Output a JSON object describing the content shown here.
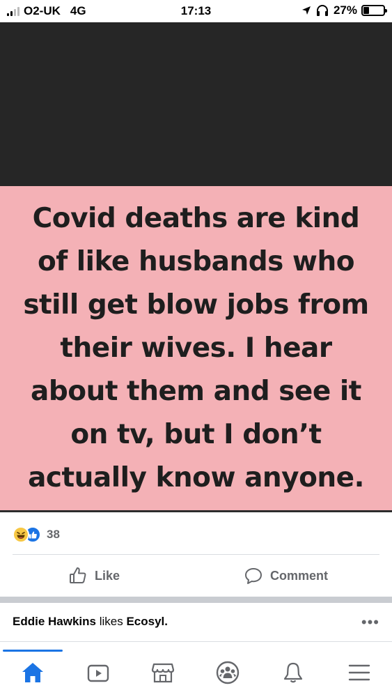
{
  "status_bar": {
    "carrier": "O2-UK",
    "network": "4G",
    "time": "17:13",
    "battery": "27%"
  },
  "post": {
    "meme_lines": [
      "Covid deaths are kind",
      "of like husbands who",
      "still get blow jobs from",
      "their wives. I hear",
      "about them and see it",
      "on tv, but I don’t",
      "actually know anyone."
    ],
    "reaction_count": "38",
    "like_label": "Like",
    "comment_label": "Comment"
  },
  "next_story": {
    "actor": "Eddie Hawkins",
    "verb": "likes",
    "page": "Ecosyl."
  },
  "tabs": {
    "active": "home",
    "items": [
      "home-icon",
      "watch-icon",
      "marketplace-icon",
      "groups-icon",
      "notifications-icon",
      "menu-icon"
    ]
  },
  "colors": {
    "meme_background": "#f4b1b6",
    "dark_band": "#262626",
    "accent": "#1b74e4",
    "muted_text": "#65676b",
    "haha_reaction": "#f7c844"
  }
}
